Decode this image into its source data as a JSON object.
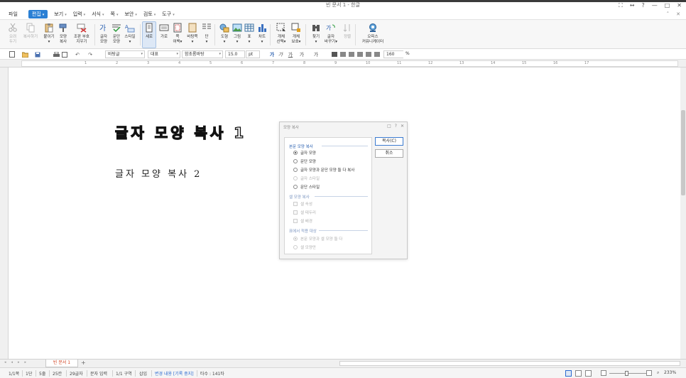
{
  "window": {
    "title": "빈 문서 1 - 한글",
    "controls": [
      "⛶",
      "↔",
      "?",
      "—",
      "□",
      "✕"
    ]
  },
  "menu": {
    "items": [
      {
        "label": "파일",
        "arrow": ""
      },
      {
        "label": "편집",
        "arrow": "▾"
      },
      {
        "label": "보기",
        "arrow": "▾"
      },
      {
        "label": "입력",
        "arrow": "▾"
      },
      {
        "label": "서식",
        "arrow": "▾"
      },
      {
        "label": "쪽",
        "arrow": "▾"
      },
      {
        "label": "보안",
        "arrow": "▾"
      },
      {
        "label": "검토",
        "arrow": "▾"
      },
      {
        "label": "도구",
        "arrow": "▾"
      }
    ],
    "right": [
      "˄",
      "✕"
    ]
  },
  "ribbon": [
    {
      "label": "오려\n두기",
      "disabled": true
    },
    {
      "label": "복사하기",
      "disabled": true
    },
    {
      "label": "붙이기\n▾",
      "disabled": false
    },
    {
      "label": "모양\n복사",
      "disabled": false
    },
    {
      "label": "조판 부호\n지우기",
      "disabled": false
    },
    {
      "label": "글자\n모양",
      "disabled": false
    },
    {
      "label": "문단\n모양",
      "disabled": false
    },
    {
      "label": "스타일\n▾",
      "disabled": false
    },
    {
      "label": "세로",
      "disabled": false
    },
    {
      "label": "가로",
      "disabled": false
    },
    {
      "label": "쪽\n여백▾",
      "disabled": false
    },
    {
      "label": "바탕쪽\n▾",
      "disabled": false
    },
    {
      "label": "단\n▾",
      "disabled": false
    },
    {
      "label": "도형\n▾",
      "disabled": false
    },
    {
      "label": "그림\n▾",
      "disabled": false
    },
    {
      "label": "표\n▾",
      "disabled": false
    },
    {
      "label": "차트\n▾",
      "disabled": false
    },
    {
      "label": "개체\n선택▾",
      "disabled": false
    },
    {
      "label": "개체\n보호▾",
      "disabled": false
    },
    {
      "label": "찾기\n▾",
      "disabled": false
    },
    {
      "label": "글자\n바꾸기▾",
      "disabled": false
    },
    {
      "label": "정렬",
      "disabled": true
    },
    {
      "label": "오피스\n커뮤니케이터",
      "disabled": false
    }
  ],
  "format": {
    "style": "바탕글",
    "font_kind": "대표",
    "font": "함초롬바탕",
    "size": "15.0",
    "unit": "pt",
    "line_spacing": "160",
    "percent": "%",
    "text_buttons": [
      "가",
      "가",
      "가",
      "가",
      "가"
    ]
  },
  "ruler_ticks": [
    "1",
    "2",
    "3",
    "4",
    "5",
    "6",
    "7",
    "8",
    "9",
    "10",
    "11",
    "12",
    "13",
    "14",
    "15",
    "16",
    "17"
  ],
  "document": {
    "heading1": "글자 모양 복사 1",
    "heading2": "글자 모양 복사 2"
  },
  "dialog": {
    "title": "모양 복사",
    "controls": [
      "□",
      "?",
      "✕"
    ],
    "group_body": "본문 모양 복사",
    "options_body": [
      {
        "label": "글자 모양",
        "checked": true,
        "disabled": false
      },
      {
        "label": "문단 모양",
        "checked": false,
        "disabled": false
      },
      {
        "label": "글자 모양과 문단 모양 둘 다 복사",
        "checked": false,
        "disabled": false
      },
      {
        "label": "글자 스타일",
        "checked": false,
        "disabled": true
      },
      {
        "label": "문단 스타일",
        "checked": false,
        "disabled": false
      }
    ],
    "group_cell": "셀 모양 복사",
    "options_cell": [
      "셀 속성",
      "셀 테두리",
      "셀 배경"
    ],
    "group_table": "표에서 적용 대상",
    "options_table": [
      {
        "label": "본문 모양과 셀 모양 둘 다",
        "checked": true
      },
      {
        "label": "셀 모양만",
        "checked": false
      }
    ],
    "copy_button": "복사(C)",
    "cancel_button": "취소"
  },
  "tabs": {
    "doc_tab": "빈 문서 1",
    "add": "+",
    "nav": [
      "◂",
      "◂",
      "▸",
      "▸"
    ]
  },
  "status": {
    "page": "1/1쪽",
    "section": "1단",
    "line": "5줄",
    "column": "25칸",
    "chars": "29글자",
    "input_mode": "문자 입력",
    "area": "1/1 구역",
    "insert": "삽입",
    "track": "변경 내용 [기록 중지]",
    "typing": "타수 : 141타",
    "zoom": "233%"
  }
}
